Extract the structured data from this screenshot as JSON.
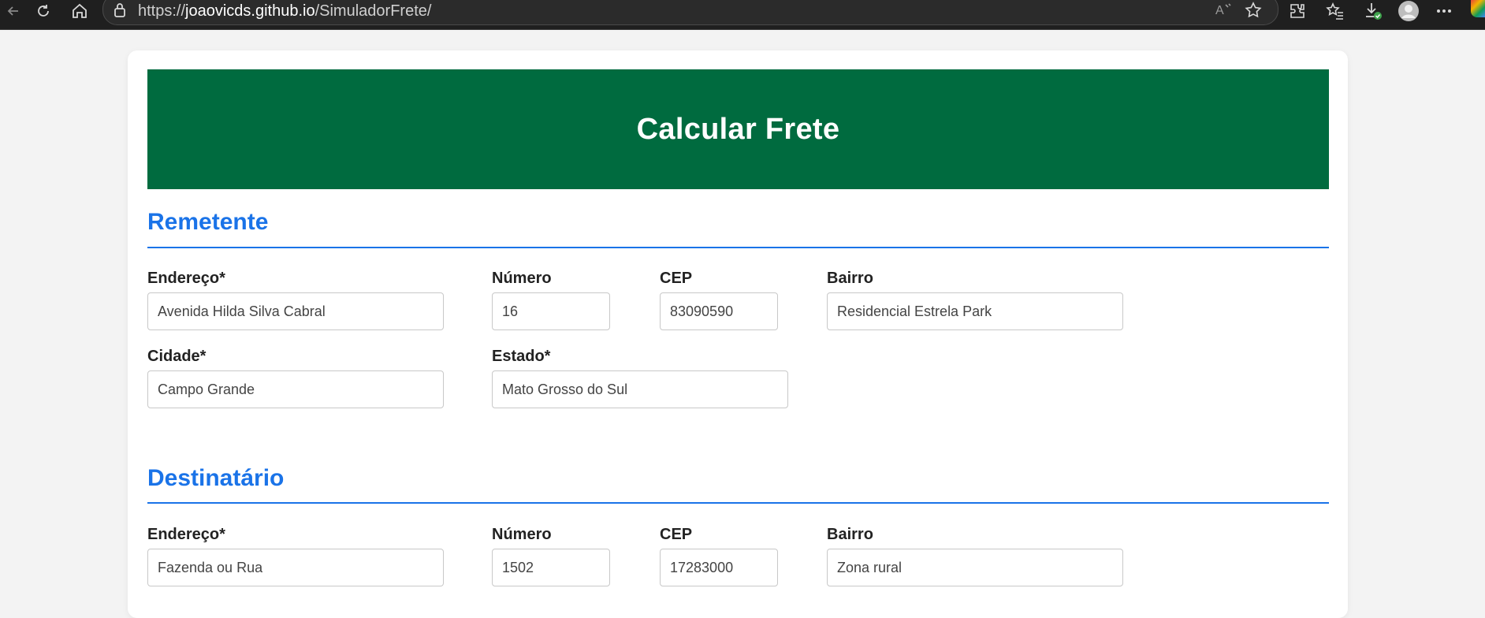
{
  "browser": {
    "url_scheme": "https://",
    "url_host": "joaovicds.github.io",
    "url_path": "/SimuladorFrete/",
    "toolbar_icons": [
      "back-icon",
      "reload-icon",
      "home-icon",
      "lock-icon",
      "read-aloud-icon",
      "favorite-star-icon",
      "extensions-icon",
      "favorites-icon",
      "downloads-icon",
      "profile-avatar-icon",
      "more-options-icon"
    ]
  },
  "banner": {
    "title": "Calcular Frete",
    "color": "#006b3f"
  },
  "accent_color": "#1a73e8",
  "sender": {
    "title": "Remetente",
    "endereco_label": "Endereço*",
    "endereco_value": "Avenida Hilda Silva Cabral",
    "numero_label": "Número",
    "numero_value": "16",
    "cep_label": "CEP",
    "cep_value": "83090590",
    "bairro_label": "Bairro",
    "bairro_value": "Residencial Estrela Park",
    "cidade_label": "Cidade*",
    "cidade_value": "Campo Grande",
    "estado_label": "Estado*",
    "estado_value": "Mato Grosso do Sul"
  },
  "recipient": {
    "title": "Destinatário",
    "endereco_label": "Endereço*",
    "endereco_value": "Fazenda ou Rua",
    "numero_label": "Número",
    "numero_value": "1502",
    "cep_label": "CEP",
    "cep_value": "17283000",
    "bairro_label": "Bairro",
    "bairro_value": "Zona rural"
  }
}
